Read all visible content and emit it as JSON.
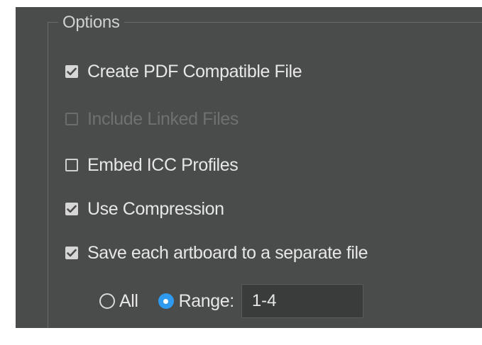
{
  "options": {
    "group_title": "Options",
    "checkboxes": [
      {
        "label": "Create PDF Compatible File",
        "checked": true,
        "enabled": true
      },
      {
        "label": "Include Linked Files",
        "checked": false,
        "enabled": false
      },
      {
        "label": "Embed ICC Profiles",
        "checked": false,
        "enabled": true
      },
      {
        "label": "Use Compression",
        "checked": true,
        "enabled": true
      },
      {
        "label": "Save each artboard to a separate file",
        "checked": true,
        "enabled": true
      }
    ],
    "artboards": {
      "all_label": "All",
      "all_selected": false,
      "range_label": "Range:",
      "range_selected": true,
      "range_value": "1-4"
    }
  },
  "colors": {
    "panel_bg": "#4a4b4b",
    "text": "#e7e7e7",
    "disabled_text": "#6f7070",
    "accent": "#2f9bf0"
  }
}
